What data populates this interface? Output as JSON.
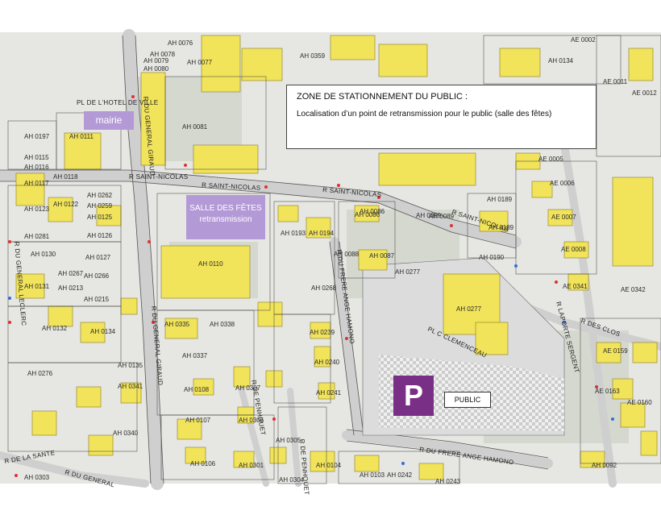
{
  "info_box": {
    "title": "ZONE DE STATIONNEMENT DU PUBLIC :",
    "text": "Localisation d’un point de retransmission pour le public (salle des fêtes)"
  },
  "callouts": {
    "mairie": "mairie",
    "salle_line1": "SALLE DES FÊTES",
    "salle_line2": "retransmission"
  },
  "parking": {
    "symbol": "P",
    "label": "PUBLIC"
  },
  "colors": {
    "building": "#f1e35a",
    "road": "#d6d6d6",
    "ground": "#e9e9e6",
    "callout": "#b39ad6",
    "parking_sign": "#7a2f86",
    "parcel_line": "#3a3a3a"
  },
  "street_labels": [
    "R SAINT-NICOLAS",
    "R SAINT-NICOLAS",
    "R SAINT-NICOLAS",
    "R SAINT-NICOLAS",
    "PL DE L'HOTEL DE VILLE",
    "R DU GENERAL GIRAUD",
    "R DU GENERAL GIRAUD",
    "R DU GENERAL LECLERC",
    "R DU FRERE ANGE HAMONO",
    "R DU FRERE ANGE HAMONO",
    "PL C CLEMENCEAU",
    "R DES CLOS",
    "R LAPORTE SERGENT",
    "R DE PENHOUET",
    "R DE PENHOUET",
    "R DE LA SANTE",
    "R DU GENERAL"
  ],
  "parcel_labels": [
    "AH 0076",
    "AH 0078",
    "AH 0077",
    "AH 0359",
    "AE 0002",
    "AH 0134",
    "AE 0011",
    "AE 0012",
    "AH 0079",
    "AH 0080",
    "AH 0081",
    "AH 0197",
    "AH 0111",
    "AH 0115",
    "AH 0116",
    "AH 0118",
    "AH 0117",
    "AH 0122",
    "AH 0123",
    "AH 0262",
    "AH 0259",
    "AH 0125",
    "AH 0126",
    "AH 0281",
    "AH 0130",
    "AH 0127",
    "AH 0193",
    "AH 0194",
    "AH 0086",
    "AH 0359",
    "AH 0189",
    "AH 0189",
    "AE 0006",
    "AE 0007",
    "AE 0008",
    "AH 0110",
    "AH 0267",
    "AH 0266",
    "AH 0131",
    "AH 0215",
    "AH 0268",
    "AH 0087",
    "AH 0277",
    "AH 0277",
    "AE 0341",
    "AE 0342",
    "AH 0132",
    "AH 0134",
    "AH 0335",
    "AH 0338",
    "AH 0239",
    "AH 0337",
    "AH 0240",
    "AE 0159",
    "AH 0135",
    "AH 0341",
    "AH 0108",
    "AH 0307",
    "AH 0241",
    "AE 0163",
    "AE 0160",
    "AH 0340",
    "AH 0107",
    "AH 0306",
    "AH 0276",
    "AH 0305",
    "AH 0106",
    "AH 0301",
    "AH 0104",
    "AH 0103",
    "AH 0242",
    "AH 0243",
    "AH 0303",
    "AH 0304",
    "AH 0092",
    "AH 0086",
    "AE 0005",
    "AH 0190",
    "AH 0088",
    "AH 0089",
    "AH 0213"
  ]
}
